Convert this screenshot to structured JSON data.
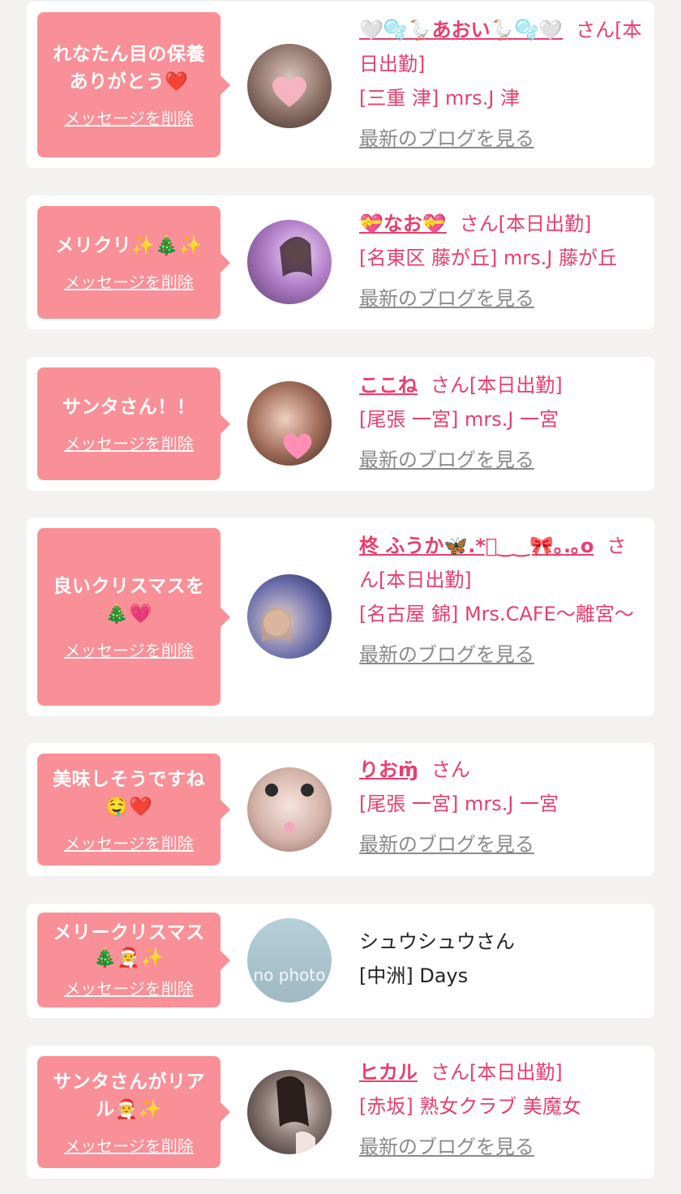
{
  "cards": [
    {
      "message": "れなたん目の保養ありがとう❤️",
      "delete_label": "メッセージを削除",
      "name": "🤍🫧🪿あおい🪿🫧🤍",
      "honorific": "さん[本日出勤]",
      "shop": "[三重 津] mrs.J 津",
      "blog_label": "最新のブログを見る"
    },
    {
      "message": "メリクリ✨🎄✨",
      "delete_label": "メッセージを削除",
      "name": "💝なお💝",
      "honorific": "さん[本日出勤]",
      "shop": "[名東区 藤が丘] mrs.J 藤が丘",
      "blog_label": "最新のブログを見る"
    },
    {
      "message": "サンタさん！！",
      "delete_label": "メッセージを削除",
      "name": "ここね",
      "honorific": "さん[本日出勤]",
      "shop": "[尾張 一宮] mrs.J 一宮",
      "blog_label": "最新のブログを見る"
    },
    {
      "message": "良いクリスマスを🎄💗",
      "delete_label": "メッセージを削除",
      "name": "柊 ふうか🦋.*ﾟ‿‿🎀｡.｡o",
      "honorific": "さん[本日出勤]",
      "shop": "[名古屋 錦] Mrs.CAFE〜離宮〜",
      "blog_label": "最新のブログを見る"
    },
    {
      "message": "美味しそうですね🤤❤️",
      "delete_label": "メッセージを削除",
      "name": "りおɱ̆̈",
      "honorific": "さん",
      "shop": "[尾張 一宮] mrs.J 一宮",
      "blog_label": "最新のブログを見る"
    },
    {
      "message": "メリークリスマス🎄🧑‍🎄✨",
      "delete_label": "メッセージを削除",
      "name": "シュウシュウさん",
      "honorific": "",
      "shop": "[中洲] Days",
      "avatar_text": "no photo"
    },
    {
      "message": "サンタさんがリアル🧑‍🎄✨",
      "delete_label": "メッセージを削除",
      "name": "ヒカル",
      "honorific": "さん[本日出勤]",
      "shop": "[赤坂] 熟女クラブ 美魔女",
      "blog_label": "最新のブログを見る"
    }
  ],
  "colors": {
    "background": "#f4f1f1",
    "bubble": "#f98f97",
    "accent_text": "#e83e6e",
    "link_gray": "#8a8a8a"
  }
}
